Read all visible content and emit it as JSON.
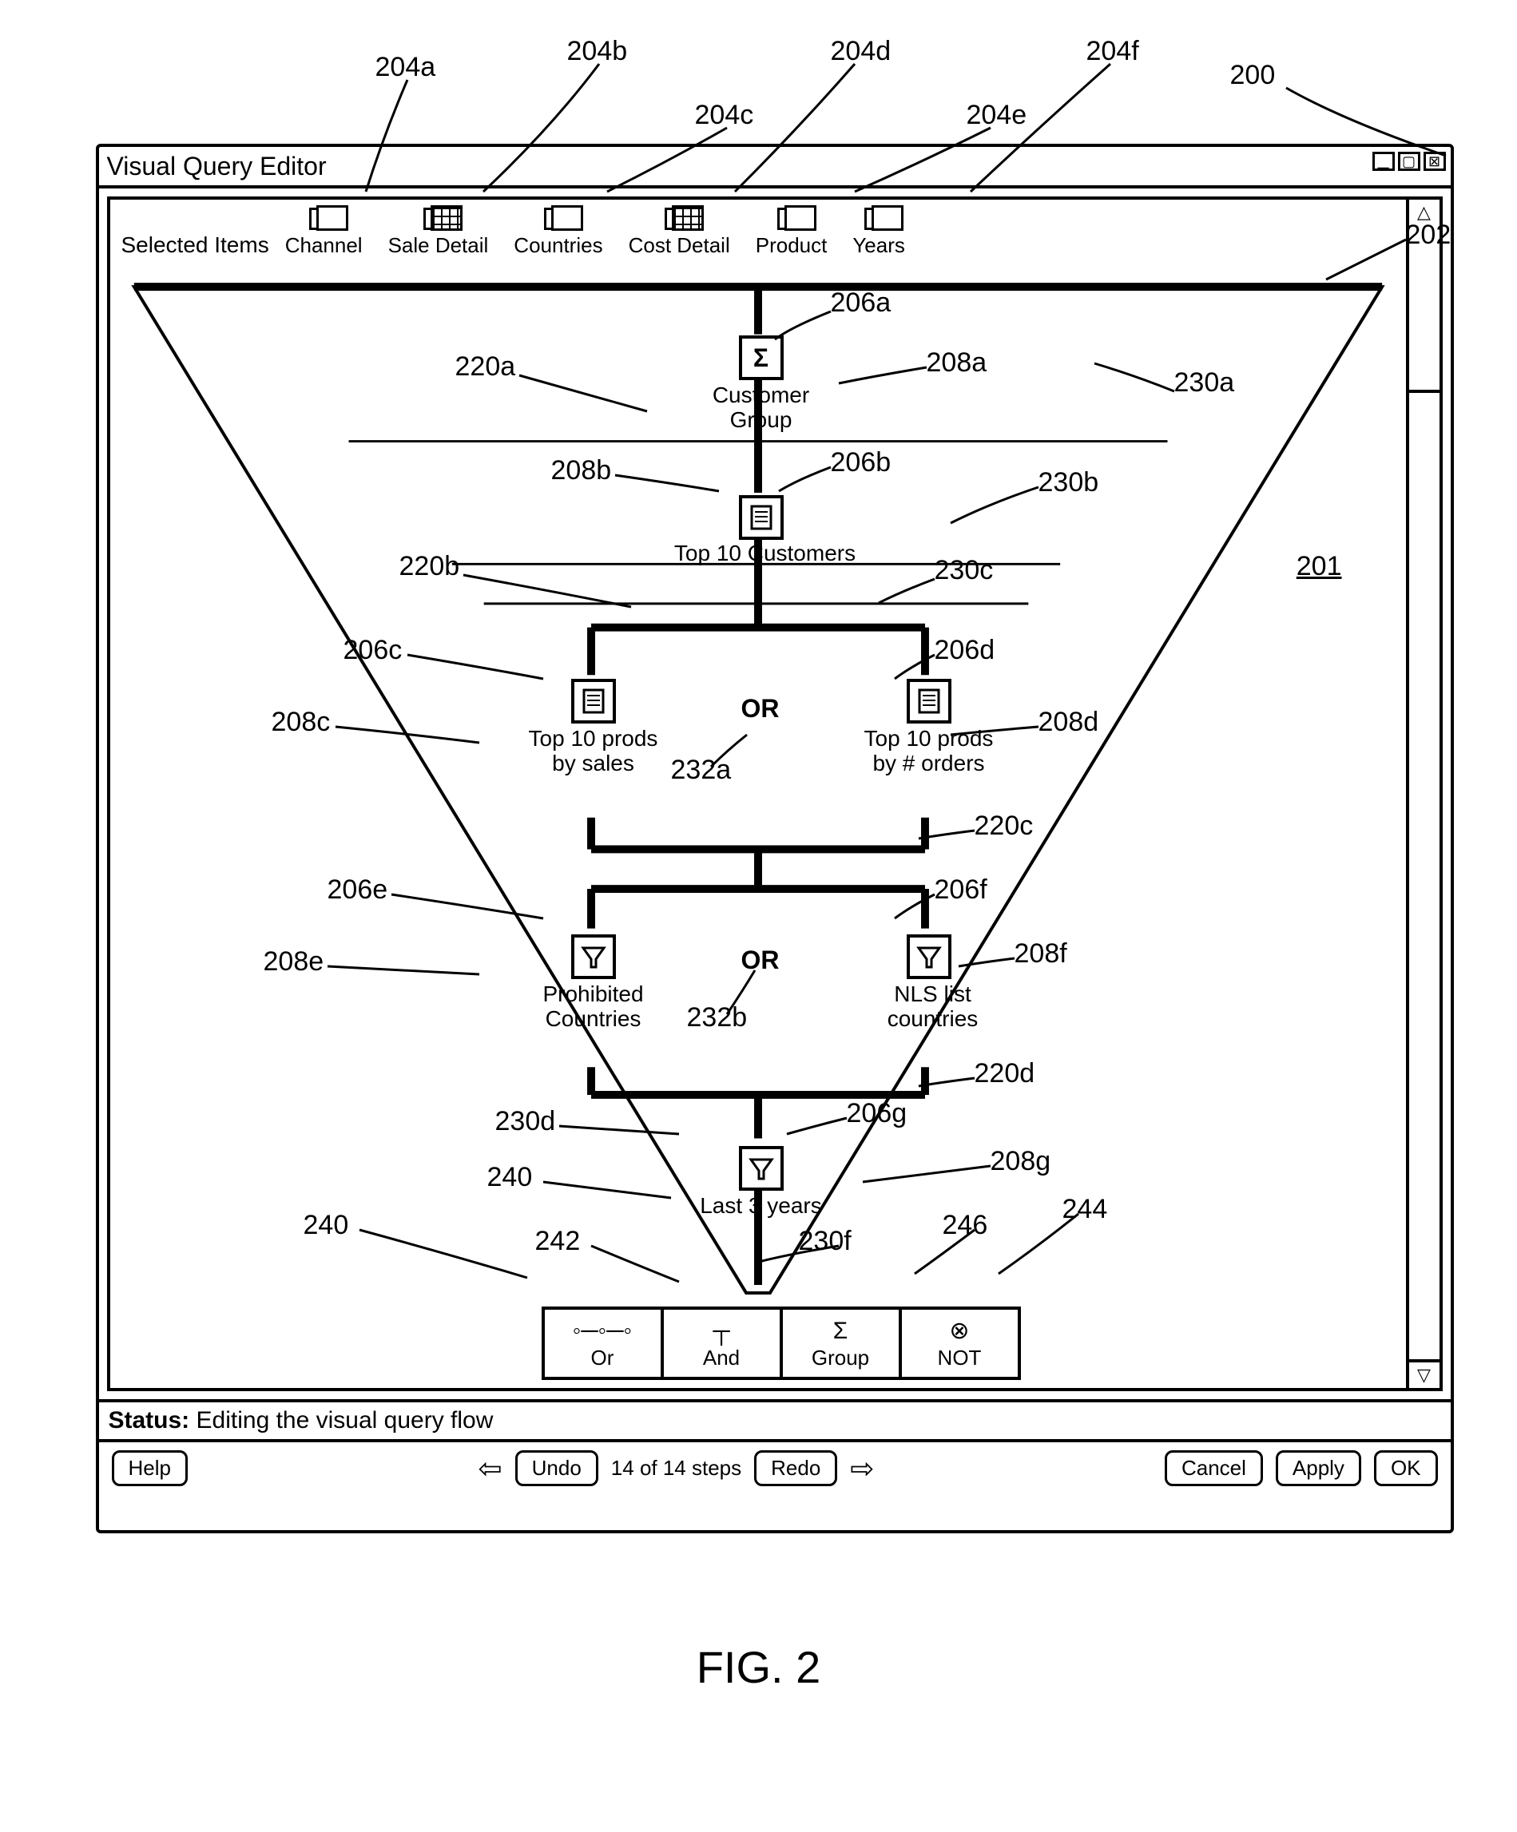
{
  "domain": "Diagram",
  "figure_label": "FIG. 2",
  "window": {
    "title": "Visual Query Editor",
    "ref": "200"
  },
  "selected_items_label": "Selected Items",
  "selected_items": [
    {
      "ref": "204a",
      "label": "Channel",
      "grid": false
    },
    {
      "ref": "204b",
      "label": "Sale Detail",
      "grid": true
    },
    {
      "ref": "204c",
      "label": "Countries",
      "grid": false
    },
    {
      "ref": "204d",
      "label": "Cost Detail",
      "grid": true
    },
    {
      "ref": "204e",
      "label": "Product",
      "grid": false
    },
    {
      "ref": "204f",
      "label": "Years",
      "grid": false
    }
  ],
  "canvas_ref": "201",
  "funnel_ref_top": "202",
  "nodes": {
    "n_206a": {
      "label_top": "Customer",
      "label_bottom": "Group",
      "icon": "Σ",
      "ref_icon": "206a",
      "ref_label": "208a"
    },
    "n_206b": {
      "label": "Top 10 Customers",
      "icon": "doc",
      "ref_icon": "206b",
      "ref_label": "208b"
    },
    "n_206c": {
      "label_top": "Top 10 prods",
      "label_bottom": "by sales",
      "icon": "doc",
      "ref_icon": "206c",
      "ref_label": "208c"
    },
    "n_206d": {
      "label_top": "Top 10 prods",
      "label_bottom": "by # orders",
      "icon": "doc",
      "ref_icon": "206d",
      "ref_label": "208d"
    },
    "n_206e": {
      "label_top": "Prohibited",
      "label_bottom": "Countries",
      "icon": "funnel",
      "ref_icon": "206e",
      "ref_label": "208e"
    },
    "n_206f": {
      "label_top": "NLS list",
      "label_bottom": "countries",
      "icon": "funnel",
      "ref_icon": "206f",
      "ref_label": "208f"
    },
    "n_206g": {
      "label": "Last 3 years",
      "icon": "funnel",
      "ref_icon": "206g",
      "ref_label": "208g"
    }
  },
  "or_labels": {
    "or1": "OR",
    "or2": "OR",
    "ref_or1": "232a",
    "ref_or2": "232b"
  },
  "branch_refs": {
    "b1": "220a",
    "b2": "220b",
    "b3": "220c",
    "b4": "220d"
  },
  "side_refs": {
    "s1": "230a",
    "s2": "230b",
    "s3": "230c",
    "s4": "230d",
    "s5": "230f"
  },
  "extra_refs": {
    "e240a": "240",
    "e240b": "240",
    "e242": "242",
    "e244": "244",
    "e246": "246"
  },
  "toolbar": {
    "or": {
      "label": "Or",
      "glyph": "◦─◦─◦"
    },
    "and": {
      "label": "And",
      "glyph": "┬"
    },
    "group": {
      "label": "Group",
      "glyph": "Σ"
    },
    "not": {
      "label": "NOT",
      "glyph": "⊗"
    }
  },
  "status": {
    "prefix": "Status:",
    "text": "Editing the visual query flow"
  },
  "footer": {
    "help": "Help",
    "undo": "Undo",
    "steps": "14 of 14 steps",
    "redo": "Redo",
    "cancel": "Cancel",
    "apply": "Apply",
    "ok": "OK"
  }
}
